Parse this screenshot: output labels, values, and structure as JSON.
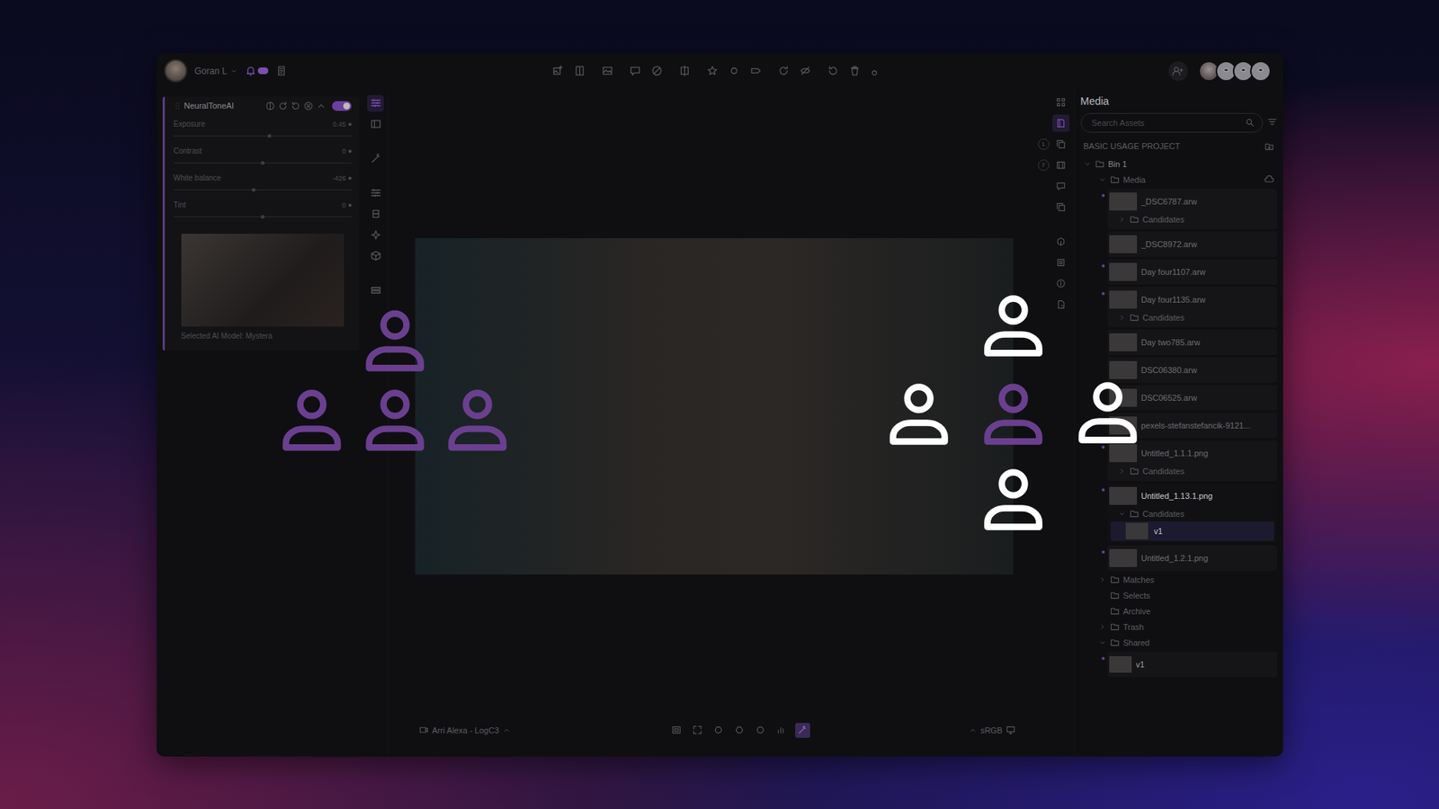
{
  "user": {
    "name": "Goran L",
    "has_notifications": true
  },
  "tools": [
    {
      "selected": true
    },
    {
      "selected": false
    },
    {
      "selected": false
    },
    {
      "selected": false
    },
    {
      "selected": false
    },
    {
      "selected": false
    },
    {
      "selected": false
    },
    {
      "selected": false
    }
  ],
  "panel": {
    "title": "NeuralToneAI",
    "enabled": true,
    "sliders": [
      {
        "label": "Exposure",
        "value": "0.45",
        "level": 0.54
      },
      {
        "label": "Contrast",
        "value": "0",
        "level": 0.5
      },
      {
        "label": "White balance",
        "value": "-426",
        "level": 0.45
      },
      {
        "label": "Tint",
        "value": "0",
        "level": 0.5
      }
    ],
    "model_caption": "Selected AI Model: Mystera"
  },
  "viewer": {
    "camera": "Arri Alexa - LogC3",
    "color_space": "sRGB",
    "view_tools": [
      {
        "selected": false
      },
      {
        "selected": false
      },
      {
        "selected": false
      },
      {
        "selected": false
      },
      {
        "selected": false
      },
      {
        "selected": false
      },
      {
        "selected": true
      }
    ]
  },
  "side_badges": [
    "1",
    "7"
  ],
  "media": {
    "title": "Media",
    "search_placeholder": "Search Assets",
    "project": "BASIC USAGE PROJECT",
    "bin": {
      "name": "Bin 1",
      "expanded": true
    },
    "folder": {
      "name": "Media",
      "expanded": true
    },
    "assets": [
      {
        "name": "_DSC6787.arw",
        "dot": true,
        "selected": false,
        "candidates": {
          "label": "Candidates",
          "expanded": false,
          "children": []
        }
      },
      {
        "name": "_DSC8972.arw",
        "dot": false,
        "selected": false,
        "candidates": null
      },
      {
        "name": "Day four1107.arw",
        "dot": true,
        "selected": false,
        "candidates": null
      },
      {
        "name": "Day four1135.arw",
        "dot": true,
        "selected": false,
        "candidates": {
          "label": "Candidates",
          "expanded": false,
          "children": []
        }
      },
      {
        "name": "Day two785.arw",
        "dot": false,
        "selected": false,
        "candidates": null
      },
      {
        "name": "DSC06380.arw",
        "dot": false,
        "selected": false,
        "candidates": null
      },
      {
        "name": "DSC06525.arw",
        "dot": false,
        "selected": false,
        "candidates": null
      },
      {
        "name": "pexels-stefanstefancik-9121...",
        "dot": false,
        "selected": false,
        "candidates": null
      },
      {
        "name": "Untitled_1.1.1.png",
        "dot": true,
        "selected": false,
        "candidates": {
          "label": "Candidates",
          "expanded": false,
          "children": []
        }
      },
      {
        "name": "Untitled_1.13.1.png",
        "dot": true,
        "selected": true,
        "candidates": {
          "label": "Candidates",
          "expanded": true,
          "children": [
            {
              "name": "v1",
              "selected": true
            }
          ]
        }
      },
      {
        "name": "Untitled_1.2.1.png",
        "dot": true,
        "selected": false,
        "candidates": null
      }
    ],
    "folders": [
      {
        "name": "Matches",
        "expandable": true,
        "expanded": false,
        "children": []
      },
      {
        "name": "Selects",
        "expandable": false,
        "expanded": false,
        "children": []
      },
      {
        "name": "Archive",
        "expandable": false,
        "expanded": false,
        "children": []
      },
      {
        "name": "Trash",
        "expandable": true,
        "expanded": false,
        "children": []
      },
      {
        "name": "Shared",
        "expandable": true,
        "expanded": true,
        "children": [
          {
            "name": "v1",
            "dot": true
          }
        ]
      }
    ]
  },
  "collaborators": [
    {
      "color": "#6b3f8f"
    },
    {
      "color": "#6b3f8f"
    },
    {
      "color": "#6b3f8f"
    },
    {
      "color": "#6b3f8f"
    },
    {
      "color": "#ffffff"
    },
    {
      "color": "#ffffff"
    },
    {
      "color": "#6b3f8f"
    },
    {
      "color": "#ffffff"
    },
    {
      "color": "#ffffff"
    }
  ]
}
